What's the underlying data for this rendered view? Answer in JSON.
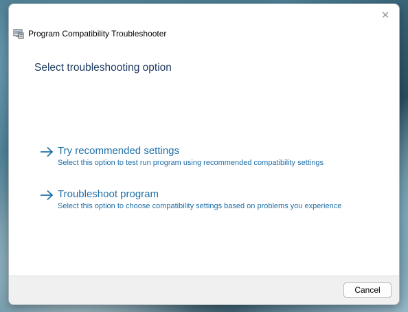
{
  "window": {
    "title": "Program Compatibility Troubleshooter",
    "close_glyph": "✕"
  },
  "main": {
    "heading": "Select troubleshooting option",
    "options": [
      {
        "title": "Try recommended settings",
        "description": "Select this option to test run program using recommended compatibility settings"
      },
      {
        "title": "Troubleshoot program",
        "description": "Select this option to choose compatibility settings based on problems you experience"
      }
    ]
  },
  "footer": {
    "cancel_label": "Cancel"
  },
  "icons": {
    "app": "compatibility-troubleshooter-icon",
    "option_arrow": "arrow-right-icon",
    "close": "close-icon"
  },
  "colors": {
    "link": "#1f6fa8",
    "heading": "#1e3a5f",
    "footer_bg": "#f0f0f0"
  }
}
